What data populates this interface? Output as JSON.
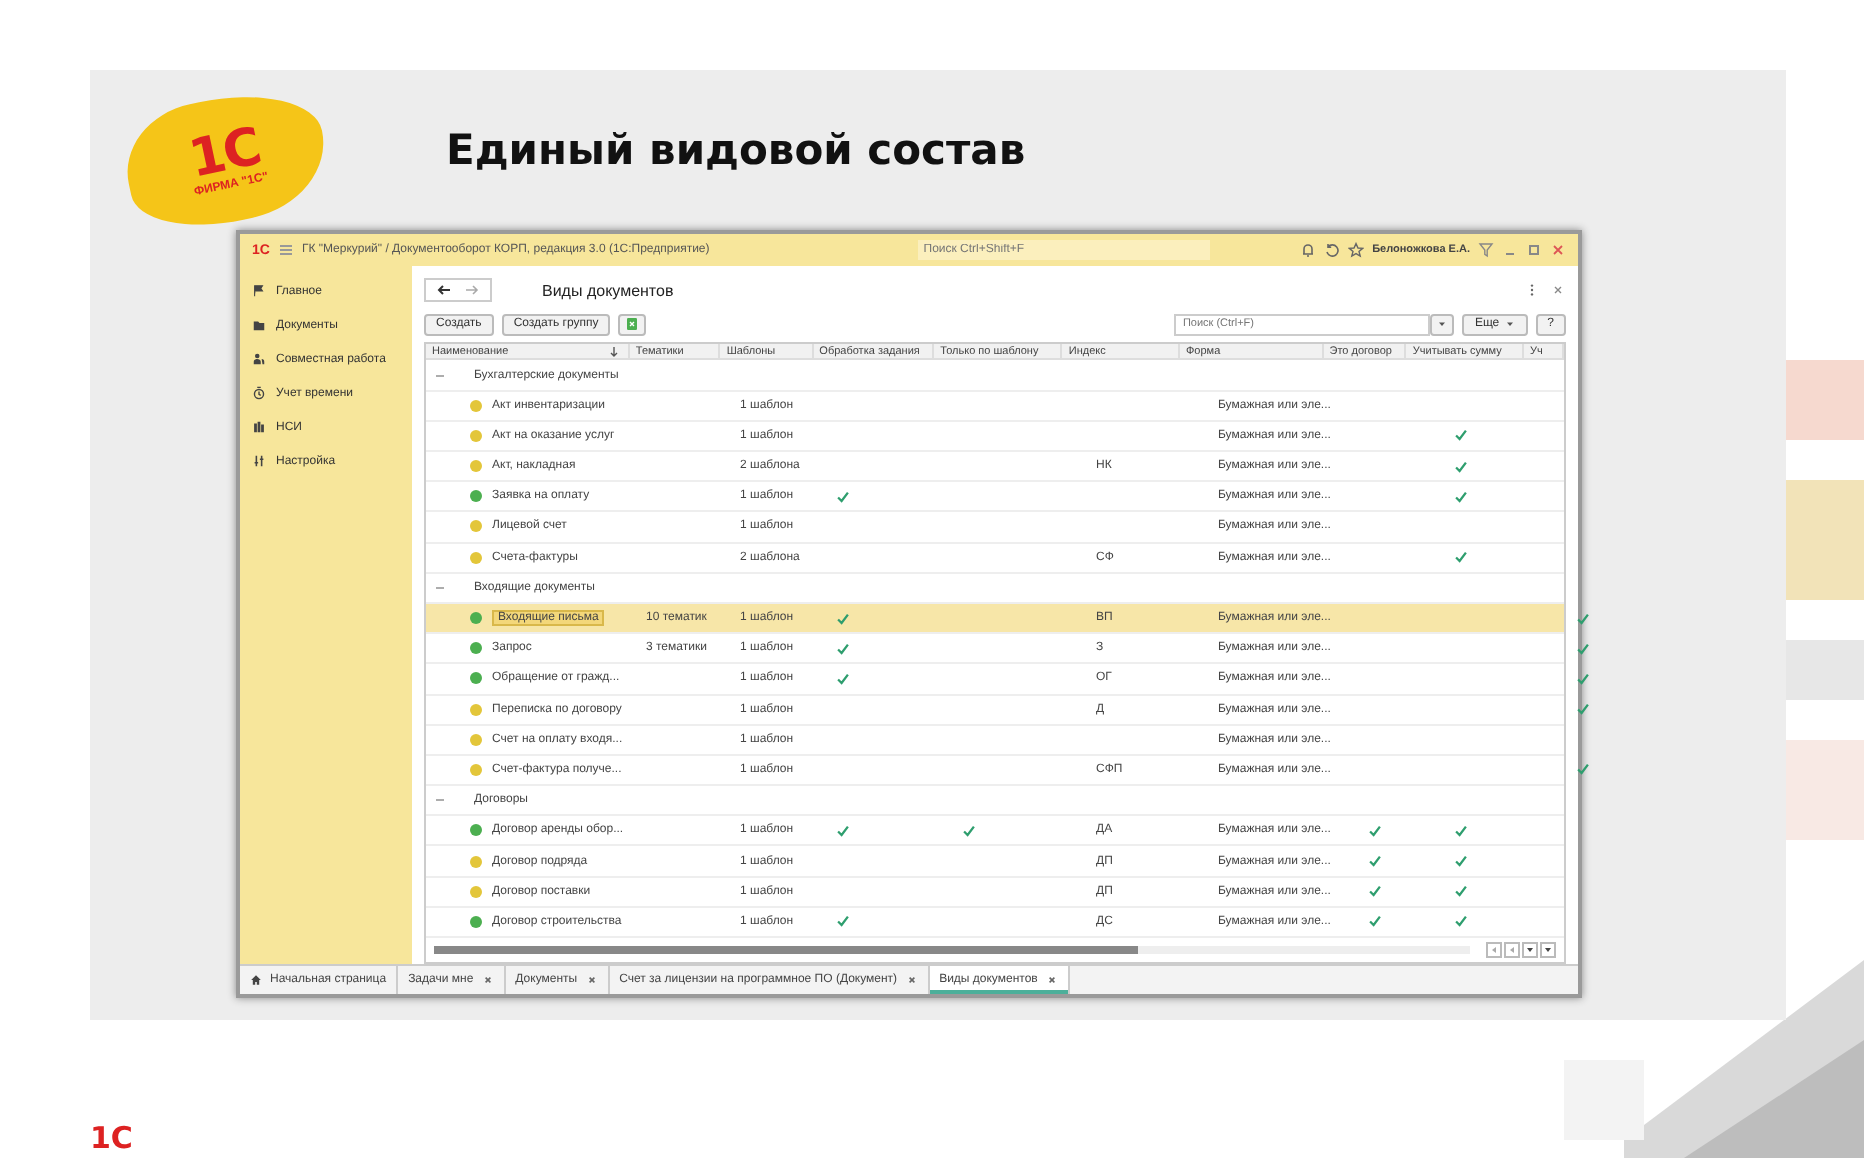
{
  "slide": {
    "logo": {
      "mark": "1С",
      "caption": "ФИРМА \"1С\""
    },
    "title": "Единый видовой состав",
    "footer_logo": "1С"
  },
  "window": {
    "logo": "1С",
    "title": "ГК \"Меркурий\" / Документооборот КОРП, редакция 3.0  (1С:Предприятие)",
    "search": {
      "placeholder": "Поиск Ctrl+Shift+F"
    },
    "user": "Белоножкова Е.А."
  },
  "sidebar": {
    "items": [
      {
        "label": "Главное"
      },
      {
        "label": "Документы"
      },
      {
        "label": "Совместная работа"
      },
      {
        "label": "Учет времени"
      },
      {
        "label": "НСИ"
      },
      {
        "label": "Настройка"
      }
    ]
  },
  "form": {
    "title": "Виды документов",
    "buttons": [
      "Создать",
      "Создать группу"
    ],
    "search": {
      "placeholder": "Поиск (Ctrl+F)"
    },
    "more": "Еще",
    "help": "?"
  },
  "table": {
    "columns": [
      "Наименование",
      "Тематики",
      "Шаблоны",
      "Обработка задания",
      "Только по шаблону",
      "Индекс",
      "Форма",
      "Это договор",
      "Учитывать сумму",
      "Уч"
    ],
    "groups": [
      {
        "name": "Бухгалтерские документы",
        "expanded": true,
        "rows": [
          {
            "name": "Акт инвентаризации",
            "color": "#e3c63a",
            "topics": "",
            "templates": "1 шаблон",
            "processing": false,
            "template_only": false,
            "index": "",
            "form": "Бумажная или эле...",
            "contract": false,
            "count_sum": false,
            "column_10": false,
            "selected": false
          },
          {
            "name": "Акт на оказание услуг",
            "color": "#e3c63a",
            "topics": "",
            "templates": "1 шаблон",
            "processing": false,
            "template_only": false,
            "index": "",
            "form": "Бумажная или эле...",
            "contract": false,
            "count_sum": true,
            "column_10": false,
            "selected": false
          },
          {
            "name": "Акт, накладная",
            "color": "#e3c63a",
            "topics": "",
            "templates": "2 шаблона",
            "processing": false,
            "template_only": false,
            "index": "НК",
            "form": "Бумажная или эле...",
            "contract": false,
            "count_sum": true,
            "column_10": false,
            "selected": false
          },
          {
            "name": "Заявка на оплату",
            "color": "#4caf50",
            "topics": "",
            "templates": "1 шаблон",
            "processing": true,
            "template_only": false,
            "index": "",
            "form": "Бумажная или эле...",
            "contract": false,
            "count_sum": true,
            "column_10": false,
            "selected": false
          },
          {
            "name": "Лицевой счет",
            "color": "#e3c63a",
            "topics": "",
            "templates": "1 шаблон",
            "processing": false,
            "template_only": false,
            "index": "",
            "form": "Бумажная или эле...",
            "contract": false,
            "count_sum": false,
            "column_10": false,
            "selected": false
          },
          {
            "name": "Счета-фактуры",
            "color": "#e3c63a",
            "topics": "",
            "templates": "2 шаблона",
            "processing": false,
            "template_only": false,
            "index": "СФ",
            "form": "Бумажная или эле...",
            "contract": false,
            "count_sum": true,
            "column_10": false,
            "selected": false
          }
        ]
      },
      {
        "name": "Входящие документы",
        "expanded": true,
        "rows": [
          {
            "name": "Входящие письма",
            "color": "#4caf50",
            "topics": "10 тематик",
            "templates": "1 шаблон",
            "processing": true,
            "template_only": false,
            "index": "ВП",
            "form": "Бумажная или эле...",
            "contract": false,
            "count_sum": false,
            "column_10": true,
            "selected": true
          },
          {
            "name": "Запрос",
            "color": "#4caf50",
            "topics": "3 тематики",
            "templates": "1 шаблон",
            "processing": true,
            "template_only": false,
            "index": "З",
            "form": "Бумажная или эле...",
            "contract": false,
            "count_sum": false,
            "column_10": true,
            "selected": false
          },
          {
            "name": "Обращение от гражд...",
            "color": "#4caf50",
            "topics": "",
            "templates": "1 шаблон",
            "processing": true,
            "template_only": false,
            "index": "ОГ",
            "form": "Бумажная или эле...",
            "contract": false,
            "count_sum": false,
            "column_10": true,
            "selected": false
          },
          {
            "name": "Переписка по договору",
            "color": "#e3c63a",
            "topics": "",
            "templates": "1 шаблон",
            "processing": false,
            "template_only": false,
            "index": "Д",
            "form": "Бумажная или эле...",
            "contract": false,
            "count_sum": false,
            "column_10": true,
            "selected": false
          },
          {
            "name": "Счет на оплату входя...",
            "color": "#e3c63a",
            "topics": "",
            "templates": "1 шаблон",
            "processing": false,
            "template_only": false,
            "index": "",
            "form": "Бумажная или эле...",
            "contract": false,
            "count_sum": false,
            "column_10": false,
            "selected": false
          },
          {
            "name": "Счет-фактура получе...",
            "color": "#e3c63a",
            "topics": "",
            "templates": "1 шаблон",
            "processing": false,
            "template_only": false,
            "index": "СФП",
            "form": "Бумажная или эле...",
            "contract": false,
            "count_sum": false,
            "column_10": true,
            "selected": false
          }
        ]
      },
      {
        "name": "Договоры",
        "expanded": true,
        "rows": [
          {
            "name": "Договор аренды обор...",
            "color": "#4caf50",
            "topics": "",
            "templates": "1 шаблон",
            "processing": true,
            "template_only": true,
            "index": "ДА",
            "form": "Бумажная или эле...",
            "contract": true,
            "count_sum": true,
            "column_10": false,
            "selected": false
          },
          {
            "name": "Договор подряда",
            "color": "#e3c63a",
            "topics": "",
            "templates": "1 шаблон",
            "processing": false,
            "template_only": false,
            "index": "ДП",
            "form": "Бумажная или эле...",
            "contract": true,
            "count_sum": true,
            "column_10": false,
            "selected": false
          },
          {
            "name": "Договор поставки",
            "color": "#e3c63a",
            "topics": "",
            "templates": "1 шаблон",
            "processing": false,
            "template_only": false,
            "index": "ДП",
            "form": "Бумажная или эле...",
            "contract": true,
            "count_sum": true,
            "column_10": false,
            "selected": false
          },
          {
            "name": "Договор строительства",
            "color": "#4caf50",
            "topics": "",
            "templates": "1 шаблон",
            "processing": true,
            "template_only": false,
            "index": "ДС",
            "form": "Бумажная или эле...",
            "contract": true,
            "count_sum": true,
            "column_10": false,
            "selected": false
          }
        ]
      }
    ]
  },
  "open_tabs": [
    {
      "label": "Начальная страница",
      "kind": "home",
      "selected": false
    },
    {
      "label": "Задачи мне",
      "kind": "closable",
      "selected": false
    },
    {
      "label": "Документы",
      "kind": "closable",
      "selected": false
    },
    {
      "label": "Счет за лицензии на программное ПО (Документ)",
      "kind": "closable",
      "selected": false
    },
    {
      "label": "Виды документов",
      "kind": "closable",
      "selected": true
    }
  ]
}
